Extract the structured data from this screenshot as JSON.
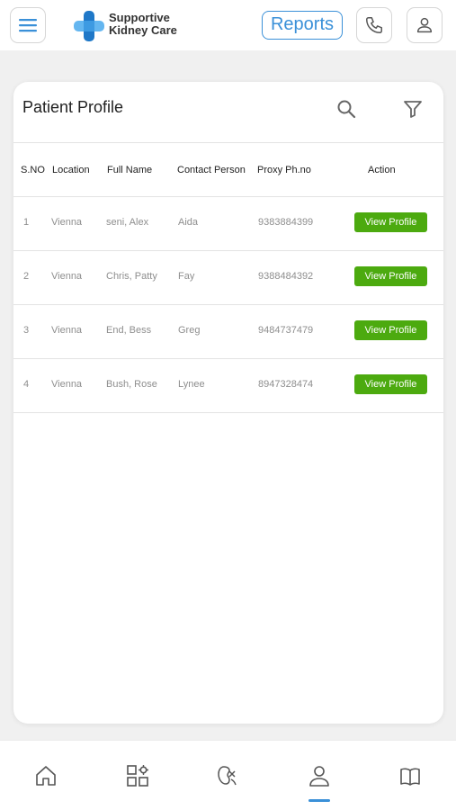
{
  "header": {
    "brand_line1": "Supportive",
    "brand_line2": "Kidney Care",
    "reports_label": "Reports",
    "icons": {
      "menu": "hamburger-menu-icon",
      "logo": "medical-cross-logo",
      "phone": "phone-icon",
      "user": "user-icon"
    }
  },
  "colors": {
    "accent": "#3a90d8",
    "action_green": "#4caa0f",
    "logo_cross_dark": "#1f78c8",
    "logo_cross_light": "#64b6f0"
  },
  "card": {
    "title": "Patient Profile",
    "icons": {
      "search": "search-icon",
      "filter": "filter-icon"
    },
    "columns": [
      "S.NO",
      "Location",
      "Full Name",
      "Contact Person",
      "Proxy Ph.no",
      "Action"
    ],
    "rows": [
      {
        "sno": "1",
        "location": "Vienna",
        "full_name": "seni, Alex",
        "contact": "Aida",
        "proxy": "9383884399",
        "action": "View Profile"
      },
      {
        "sno": "2",
        "location": "Vienna",
        "full_name": "Chris, Patty",
        "contact": "Fay",
        "proxy": "9388484392",
        "action": "View Profile"
      },
      {
        "sno": "3",
        "location": "Vienna",
        "full_name": "End, Bess",
        "contact": "Greg",
        "proxy": "9484737479",
        "action": "View Profile"
      },
      {
        "sno": "4",
        "location": "Vienna",
        "full_name": "Bush, Rose",
        "contact": "Lynee",
        "proxy": "8947328474",
        "action": "View Profile"
      }
    ]
  },
  "bottom_nav": {
    "items": [
      "home-icon",
      "apps-grid-icon",
      "kidney-icon",
      "profile-icon",
      "book-icon"
    ],
    "active_index": 3
  }
}
